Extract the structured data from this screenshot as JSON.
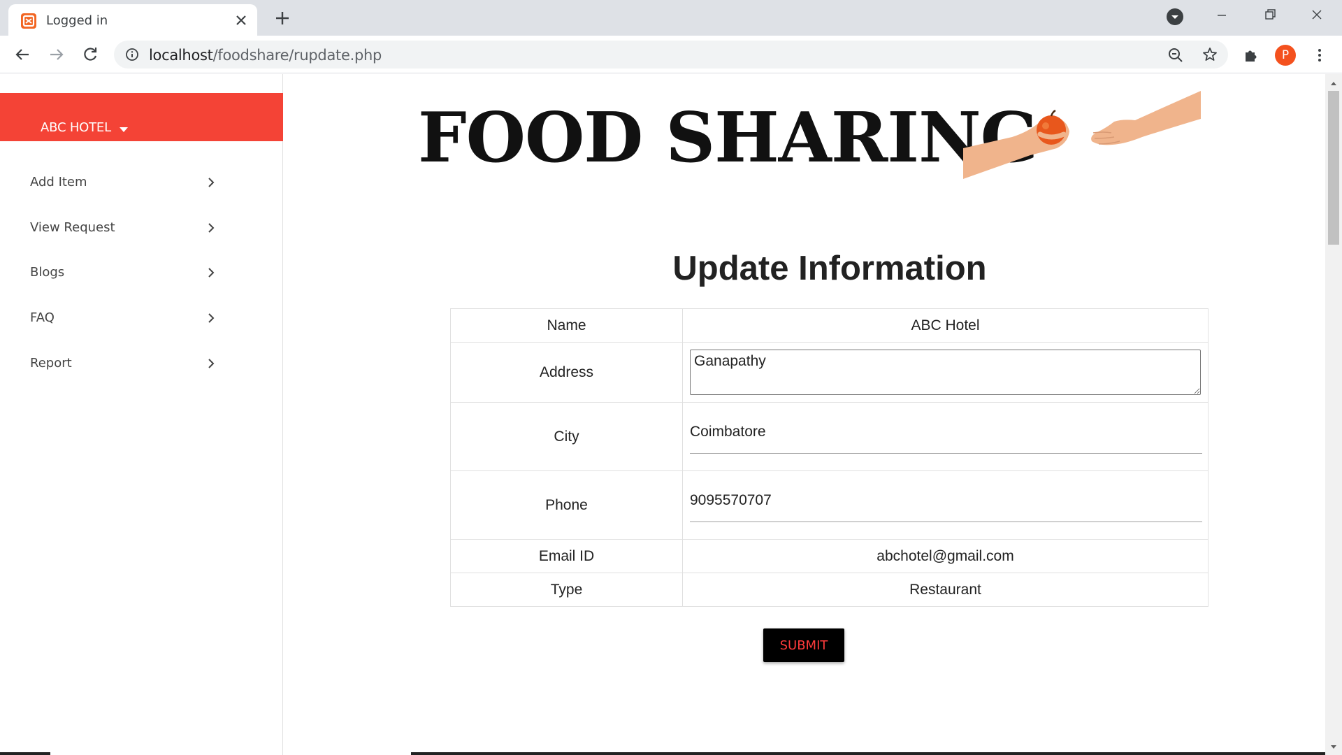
{
  "browser": {
    "tab_title": "Logged in",
    "url_host": "localhost",
    "url_path": "/foodshare/rupdate.php",
    "profile_initial": "P"
  },
  "sidebar": {
    "hotel_name": "ABC HOTEL",
    "items": [
      {
        "label": "Add Item"
      },
      {
        "label": "View Request"
      },
      {
        "label": "Blogs"
      },
      {
        "label": "FAQ"
      },
      {
        "label": "Report"
      }
    ]
  },
  "banner": {
    "title": "FOOD SHARING"
  },
  "form": {
    "title": "Update Information",
    "rows": {
      "name": {
        "label": "Name",
        "value": "ABC Hotel"
      },
      "address": {
        "label": "Address",
        "value": "Ganapathy"
      },
      "city": {
        "label": "City",
        "value": "Coimbatore"
      },
      "phone": {
        "label": "Phone",
        "value": "9095570707"
      },
      "email": {
        "label": "Email ID",
        "value": "abchotel@gmail.com"
      },
      "type": {
        "label": "Type",
        "value": "Restaurant"
      }
    },
    "submit_label": "SUBMIT"
  },
  "colors": {
    "sidebar_header": "#f44336",
    "submit_bg": "#000000",
    "submit_text": "#ff3b3b",
    "favicon": "#f26522",
    "avatar": "#f4511e"
  }
}
